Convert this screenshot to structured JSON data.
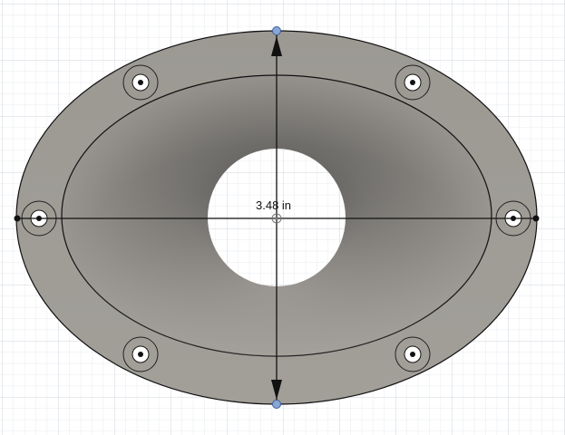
{
  "viewport": {
    "background": "#ffffff",
    "grid_minor_color": "#e7ebef",
    "grid_major_color": "#cfd6dd"
  },
  "part": {
    "name": "oval-speaker-adapter-ring",
    "body_color": "#a19e98",
    "edge_color": "#111111",
    "mounting_hole_count": 6
  },
  "dimension": {
    "text": "3.48 in",
    "orientation": "vertical"
  },
  "icons": {
    "grip_point": "blue-dot-grip",
    "center_point": "center-marker"
  }
}
